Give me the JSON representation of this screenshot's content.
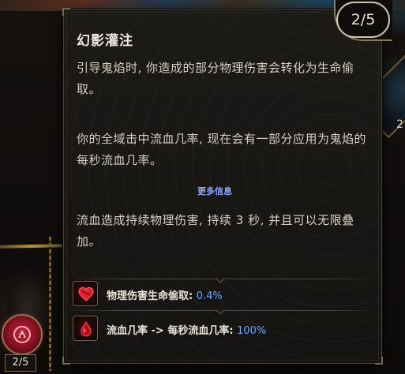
{
  "tooltip": {
    "title": "幻影灌注",
    "rank": "2/5",
    "paragraph1": "引导鬼焰时, 你造成的部分物理伤害会转化为生命偷取。",
    "paragraph2": "你的全域击中流血几率, 现在会有一部分应用为鬼焰的每秒流血几率。",
    "more_info_label": "更多信息",
    "paragraph3": "流血造成持续物理伤害, 持续 3 秒, 并且可以无限叠加。",
    "stats": [
      {
        "icon": "blood-heart-icon",
        "label": "物理伤害生命偷取:",
        "value": "0.4%"
      },
      {
        "icon": "blood-drop-icon",
        "label": "流血几率 -> 每秒流血几率:",
        "value": "100%"
      }
    ],
    "colors": {
      "value_blue": "#6aa6ff",
      "more_info": "#8fa3ff",
      "frame_gold": "#8d7a4e"
    }
  },
  "skill_node": {
    "icon": "blood-skill-icon",
    "counter": "2/5"
  },
  "background": {
    "right_node_count": "2"
  }
}
